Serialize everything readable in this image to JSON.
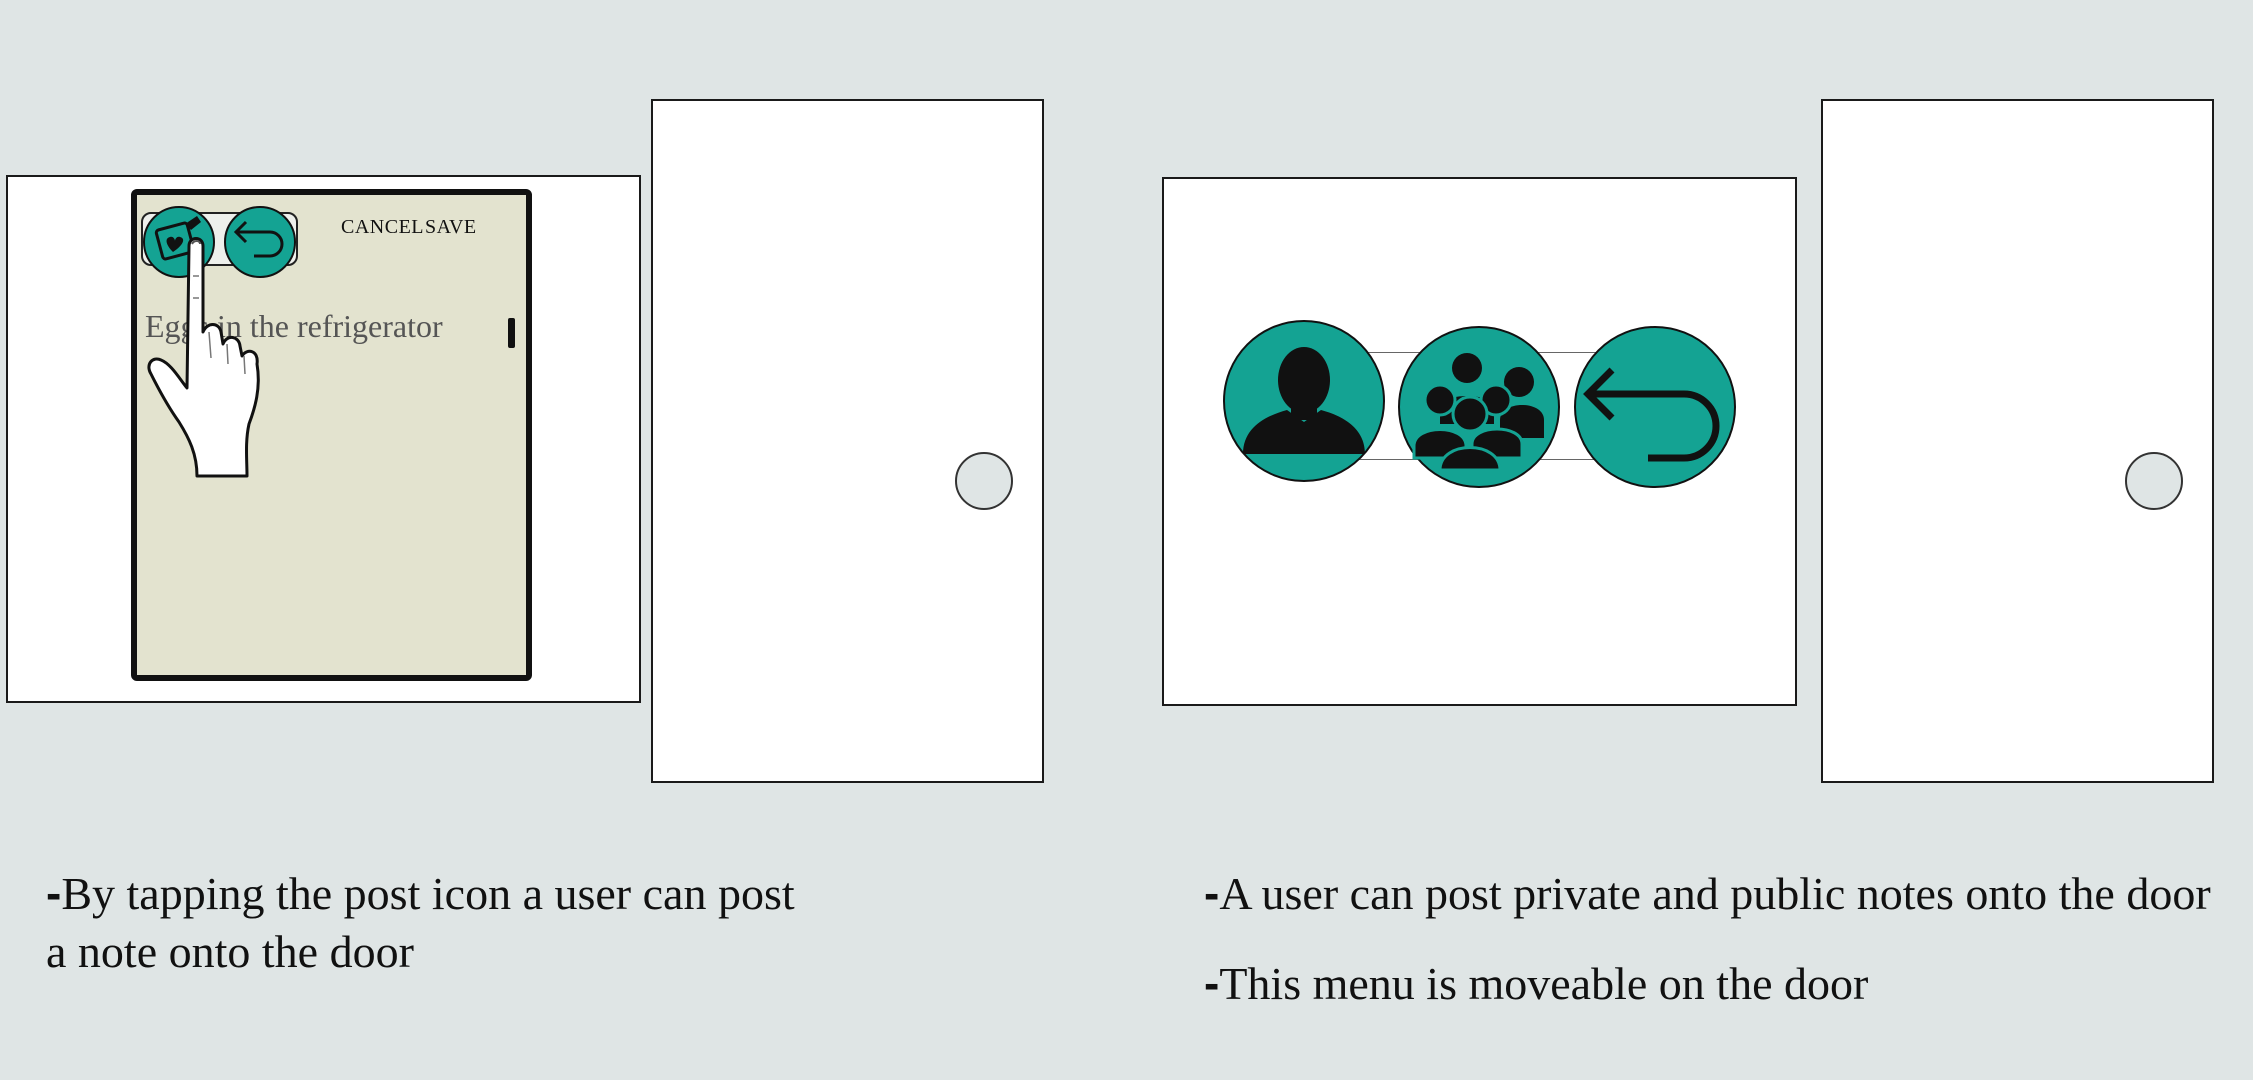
{
  "left_panel": {
    "note_buttons": {
      "cancel": "CANCEL",
      "save": "SAVE"
    },
    "note_text": "Eggs in the refrigerator",
    "icons": [
      "post-note-icon",
      "back-arrow-icon",
      "pointing-hand-icon"
    ]
  },
  "right_panel": {
    "icons": [
      "private-user-icon",
      "public-group-icon",
      "back-arrow-icon"
    ]
  },
  "captions": {
    "left": [
      "By tapping the post icon a user can post",
      "a note onto the door"
    ],
    "right_1": "A user can post private and public notes onto the door",
    "right_2": "This menu is moveable on the door"
  },
  "colors": {
    "teal": "#14a393",
    "background": "#dfe5e5",
    "note": "#e3e3cf"
  }
}
